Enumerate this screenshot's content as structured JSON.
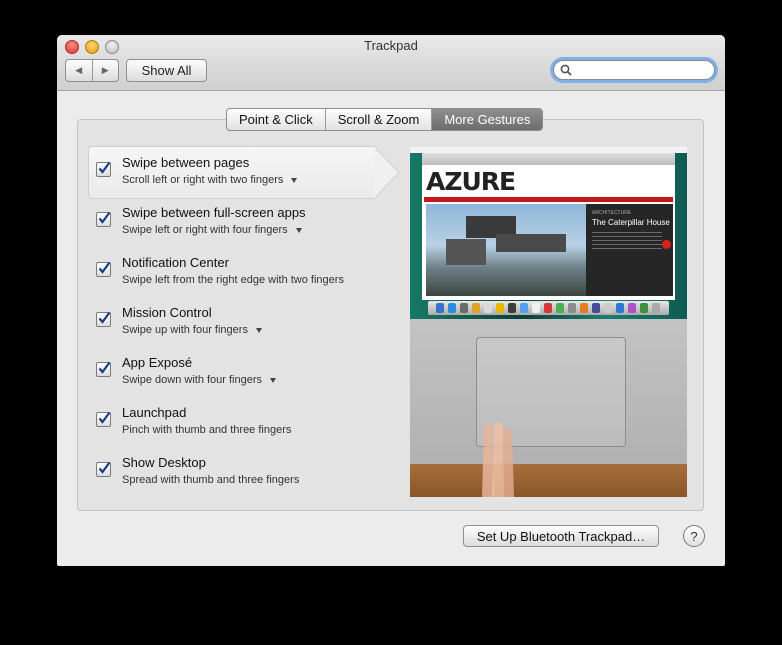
{
  "window": {
    "title": "Trackpad"
  },
  "toolbar": {
    "back_glyph": "◀",
    "forward_glyph": "▶",
    "show_all_label": "Show All",
    "search_placeholder": ""
  },
  "tabs": [
    {
      "label": "Point & Click",
      "active": false
    },
    {
      "label": "Scroll & Zoom",
      "active": false
    },
    {
      "label": "More Gestures",
      "active": true
    }
  ],
  "gestures": [
    {
      "title": "Swipe between pages",
      "desc": "Scroll left or right with two fingers",
      "checked": true,
      "has_menu": true,
      "selected": true
    },
    {
      "title": "Swipe between full-screen apps",
      "desc": "Swipe left or right with four fingers",
      "checked": true,
      "has_menu": true
    },
    {
      "title": "Notification Center",
      "desc": "Swipe left from the right edge with two fingers",
      "checked": true,
      "has_menu": false
    },
    {
      "title": "Mission Control",
      "desc": "Swipe up with four fingers",
      "checked": true,
      "has_menu": true
    },
    {
      "title": "App Exposé",
      "desc": "Swipe down with four fingers",
      "checked": true,
      "has_menu": true
    },
    {
      "title": "Launchpad",
      "desc": "Pinch with thumb and three fingers",
      "checked": true,
      "has_menu": false
    },
    {
      "title": "Show Desktop",
      "desc": "Spread with thumb and three fingers",
      "checked": true,
      "has_menu": false
    }
  ],
  "preview": {
    "site_logo": "AZURE",
    "category": "ARCHITECTURE",
    "headline": "The Caterpillar House"
  },
  "footer": {
    "bluetooth_button": "Set Up Bluetooth Trackpad…",
    "help_label": "?"
  },
  "colors": {
    "checkbox_check": "#1b3b8a",
    "active_tab": "#7a7a7a",
    "search_focus": "#7fb0e6"
  }
}
